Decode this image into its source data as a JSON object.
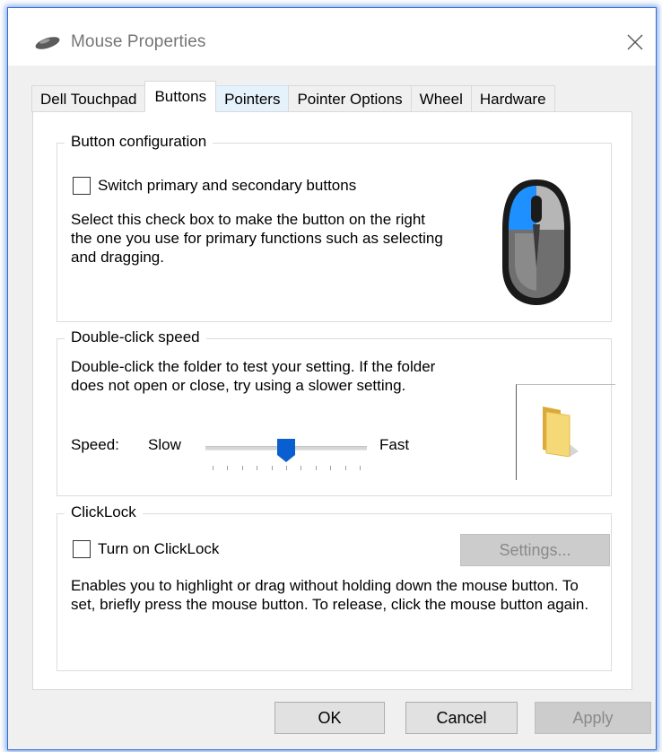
{
  "window": {
    "title": "Mouse Properties"
  },
  "tabs": [
    {
      "label": "Dell Touchpad"
    },
    {
      "label": "Buttons"
    },
    {
      "label": "Pointers"
    },
    {
      "label": "Pointer Options"
    },
    {
      "label": "Wheel"
    },
    {
      "label": "Hardware"
    }
  ],
  "active_tab": "Buttons",
  "button_config": {
    "legend": "Button configuration",
    "checkbox_label": "Switch primary and secondary buttons",
    "checked": false,
    "description": "Select this check box to make the button on the right the one you use for primary functions such as selecting and dragging.",
    "highlight_color": "#1e90ff"
  },
  "double_click": {
    "legend": "Double-click speed",
    "description": "Double-click the folder to test your setting. If the folder does not open or close, try using a slower setting.",
    "speed_label": "Speed:",
    "slow_label": "Slow",
    "fast_label": "Fast",
    "slider_value": 5,
    "slider_max": 10
  },
  "clicklock": {
    "legend": "ClickLock",
    "checkbox_label": "Turn on ClickLock",
    "checked": false,
    "settings_label": "Settings...",
    "description": "Enables you to highlight or drag without holding down the mouse button. To set, briefly press the mouse button. To release, click the mouse button again."
  },
  "footer": {
    "ok_label": "OK",
    "cancel_label": "Cancel",
    "apply_label": "Apply"
  },
  "colors": {
    "accent": "#0a5fd0",
    "window_border": "#2b6cd8",
    "folder": "#f2c94c"
  }
}
